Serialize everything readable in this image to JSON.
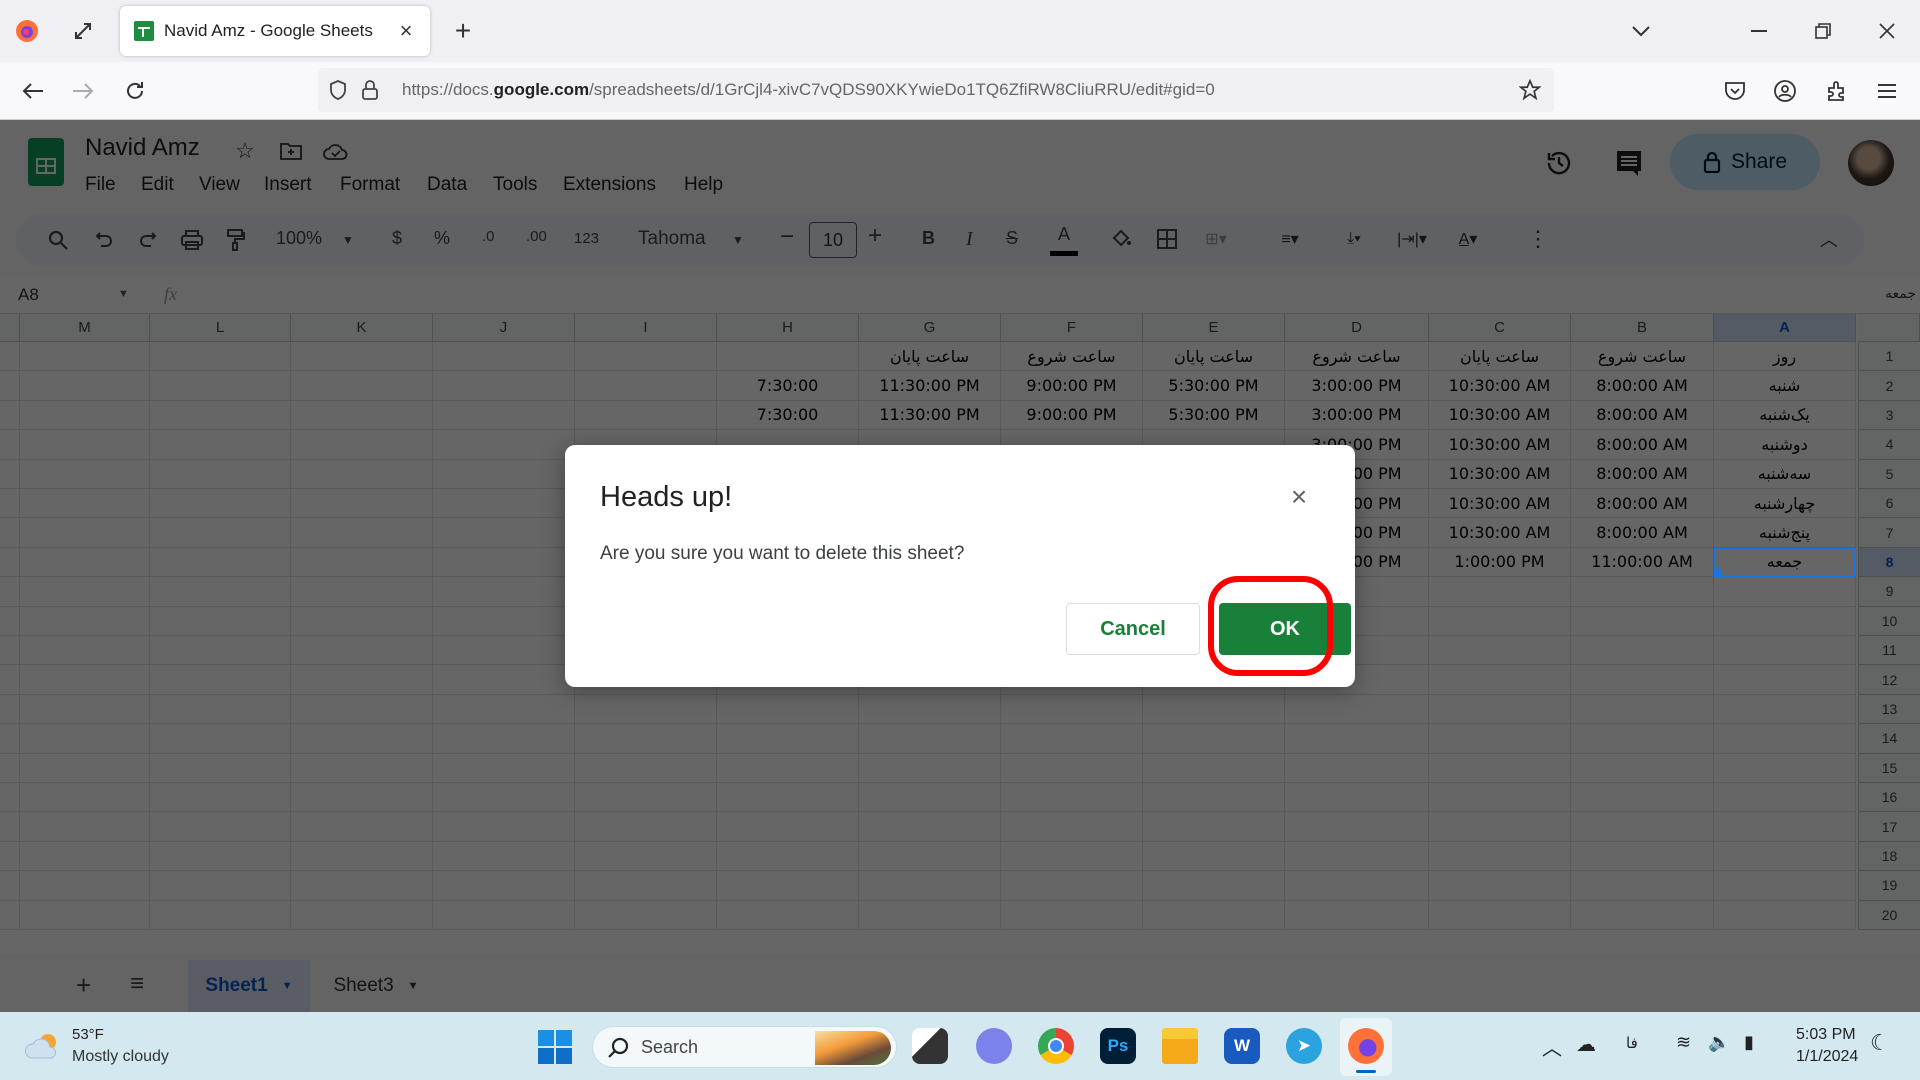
{
  "browser": {
    "tab_title": "Navid Amz - Google Sheets",
    "url_prefix": "https://docs.",
    "url_domain": "google.com",
    "url_rest": "/spreadsheets/d/1GrCjl4-xivC7vQDS90XKYwieDo1TQ6ZfiRW8CliuRRU/edit#gid=0",
    "new_tab_label": "+"
  },
  "sheets": {
    "doc_title": "Navid Amz",
    "menu": [
      "File",
      "Edit",
      "View",
      "Insert",
      "Format",
      "Data",
      "Tools",
      "Extensions",
      "Help"
    ],
    "share_label": "Share",
    "toolbar": {
      "zoom": "100%",
      "currency": "$",
      "percent": "%",
      "dec_decrease": ".0",
      "dec_increase": ".00",
      "number_format": "123",
      "font": "Tahoma",
      "font_size": "10"
    },
    "name_box": "A8",
    "fx_label": "fx",
    "formula_value": "جمعه",
    "columns": [
      "M",
      "L",
      "K",
      "J",
      "I",
      "H",
      "G",
      "F",
      "E",
      "D",
      "C",
      "B",
      "A"
    ],
    "rows": [
      {
        "n": "1",
        "cells": {
          "G": "ساعت پایان",
          "F": "ساعت شروع",
          "E": "ساعت پایان",
          "D": "ساعت شروع",
          "C": "ساعت پایان",
          "B": "ساعت شروع",
          "A": "روز"
        }
      },
      {
        "n": "2",
        "cells": {
          "H": "7:30:00",
          "G": "11:30:00 PM",
          "F": "9:00:00 PM",
          "E": "5:30:00 PM",
          "D": "3:00:00 PM",
          "C": "10:30:00 AM",
          "B": "8:00:00 AM",
          "A": "شنبه"
        }
      },
      {
        "n": "3",
        "cells": {
          "H": "7:30:00",
          "G": "11:30:00 PM",
          "F": "9:00:00 PM",
          "E": "5:30:00 PM",
          "D": "3:00:00 PM",
          "C": "10:30:00 AM",
          "B": "8:00:00 AM",
          "A": "یک‌شنبه"
        }
      },
      {
        "n": "4",
        "cells": {
          "D": "3:00:00 PM",
          "C": "10:30:00 AM",
          "B": "8:00:00 AM",
          "A": "دوشنبه"
        }
      },
      {
        "n": "5",
        "cells": {
          "D": "3:00:00 PM",
          "C": "10:30:00 AM",
          "B": "8:00:00 AM",
          "A": "سه‌شنبه"
        }
      },
      {
        "n": "6",
        "cells": {
          "D": "3:00:00 PM",
          "C": "10:30:00 AM",
          "B": "8:00:00 AM",
          "A": "چهارشنبه"
        }
      },
      {
        "n": "7",
        "cells": {
          "D": "3:00:00 PM",
          "C": "10:30:00 AM",
          "B": "8:00:00 AM",
          "A": "پنج‌شنبه"
        }
      },
      {
        "n": "8",
        "cells": {
          "D": "3:00:00 PM",
          "C": "1:00:00 PM",
          "B": "11:00:00 AM",
          "A": "جمعه"
        }
      },
      {
        "n": "9",
        "cells": {}
      },
      {
        "n": "10",
        "cells": {}
      },
      {
        "n": "11",
        "cells": {}
      },
      {
        "n": "12",
        "cells": {}
      },
      {
        "n": "13",
        "cells": {}
      },
      {
        "n": "14",
        "cells": {}
      },
      {
        "n": "15",
        "cells": {}
      },
      {
        "n": "16",
        "cells": {}
      },
      {
        "n": "17",
        "cells": {}
      },
      {
        "n": "18",
        "cells": {}
      },
      {
        "n": "19",
        "cells": {}
      },
      {
        "n": "20",
        "cells": {}
      }
    ],
    "selected_cell": "A8",
    "sheet_tabs": [
      {
        "label": "Sheet1",
        "active": true
      },
      {
        "label": "Sheet3",
        "active": false
      }
    ]
  },
  "dialog": {
    "title": "Heads up!",
    "message": "Are you sure you want to delete this sheet?",
    "cancel_label": "Cancel",
    "ok_label": "OK",
    "close_glyph": "×",
    "highlight_color": "#ff0000",
    "ok_color": "#188038"
  },
  "taskbar": {
    "weather_temp": "53°F",
    "weather_desc": "Mostly cloudy",
    "search_label": "Search",
    "lang": "فا",
    "time": "5:03 PM",
    "date": "1/1/2024"
  }
}
